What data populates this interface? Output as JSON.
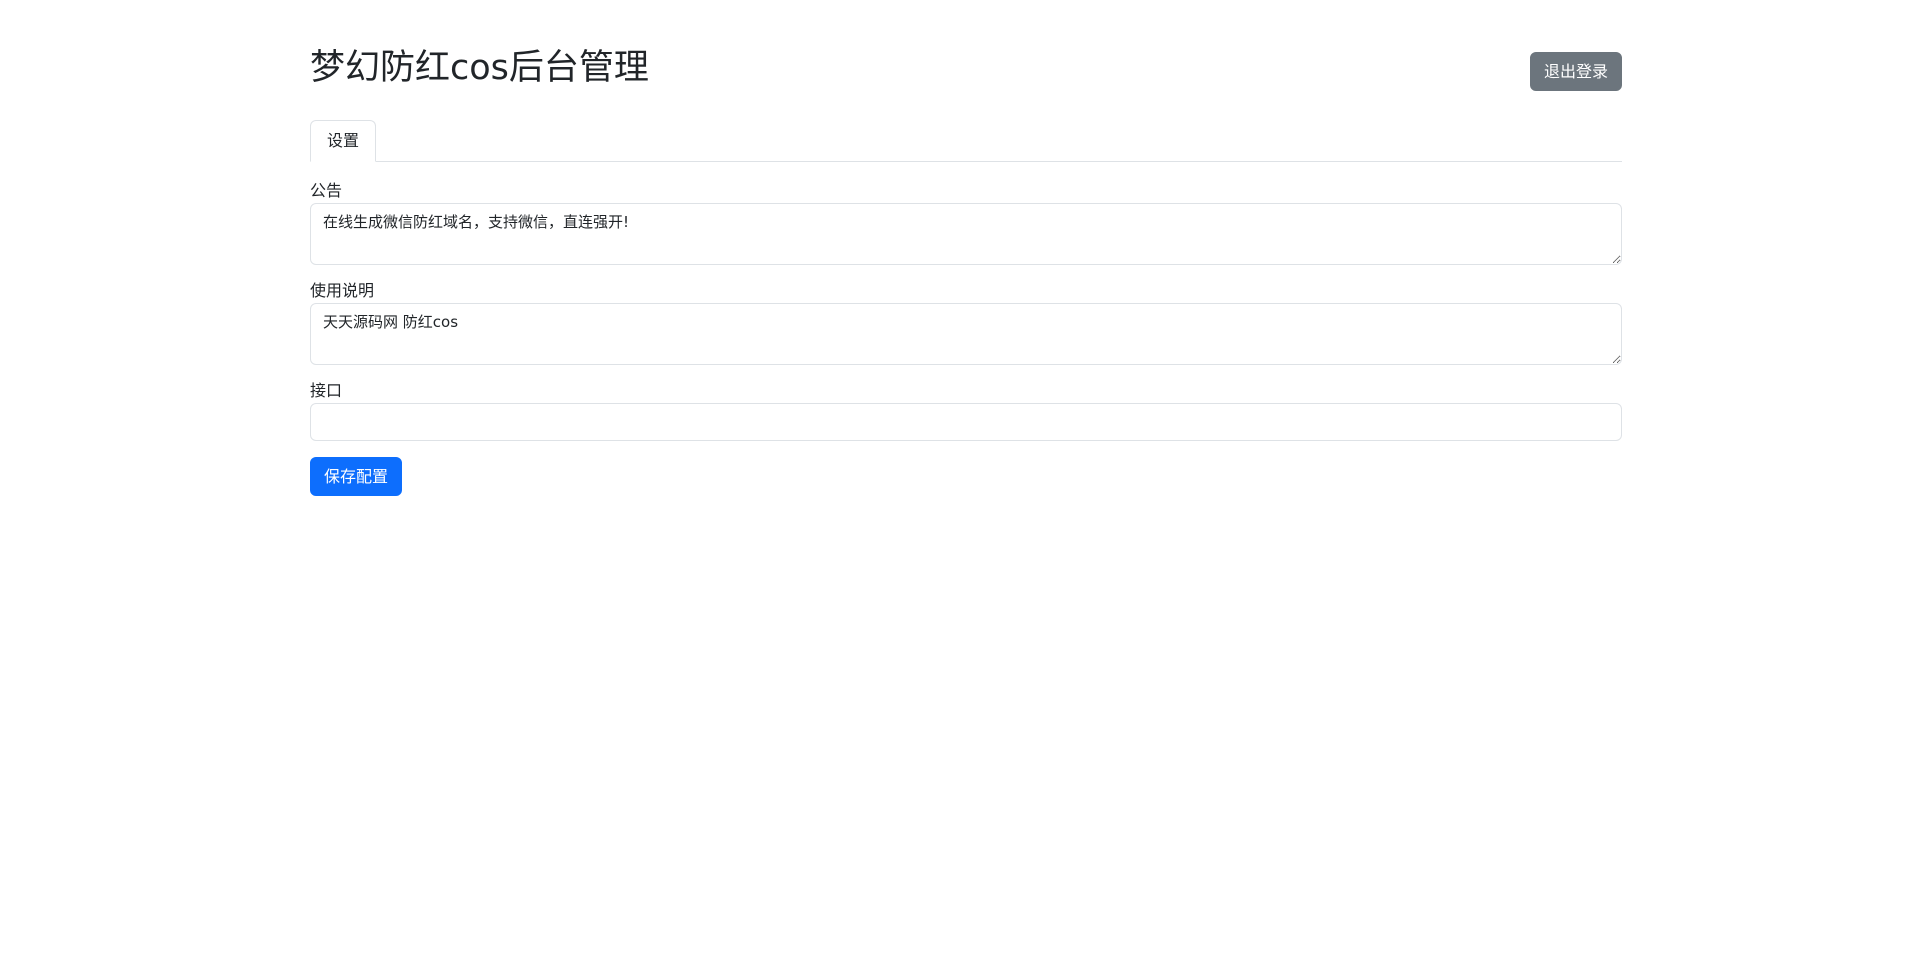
{
  "header": {
    "title": "梦幻防红cos后台管理",
    "logout_label": "退出登录"
  },
  "tabs": [
    {
      "label": "设置",
      "active": true
    }
  ],
  "form": {
    "notice": {
      "label": "公告",
      "value": "在线生成微信防红域名，支持微信，直连强开!"
    },
    "instructions": {
      "label": "使用说明",
      "value": "天天源码网 防红cos"
    },
    "api": {
      "label": "接口",
      "value": ""
    },
    "save_label": "保存配置"
  },
  "colors": {
    "primary": "#0d6efd",
    "secondary": "#6c757d",
    "border": "#dee2e6",
    "text": "#212529"
  }
}
